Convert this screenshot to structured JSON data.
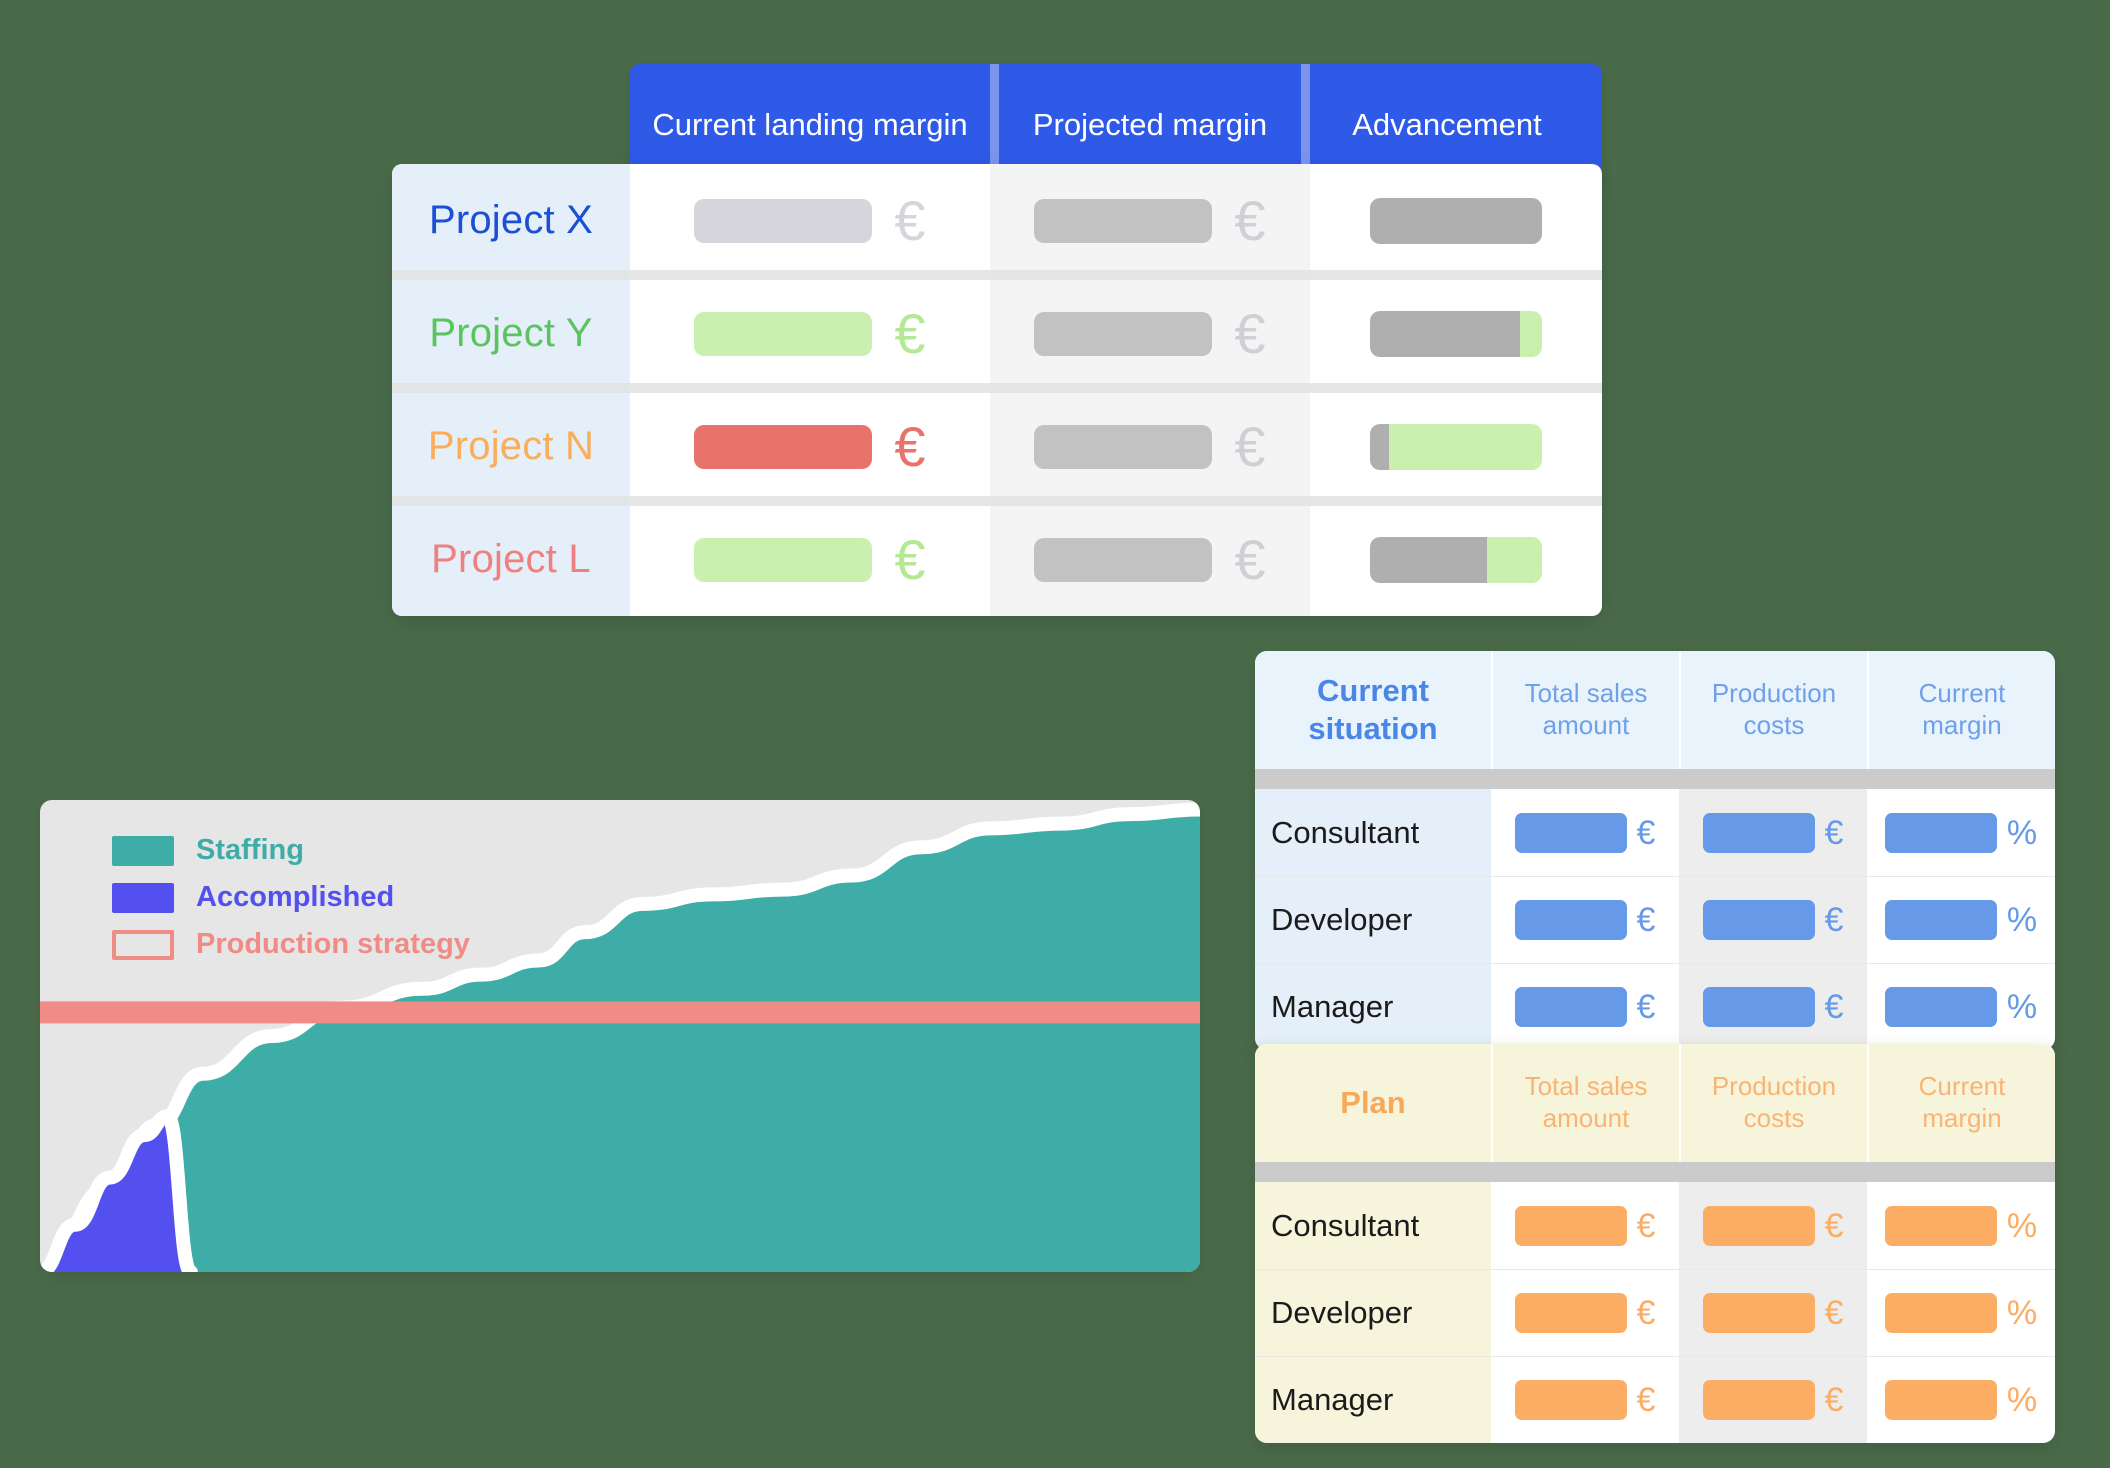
{
  "projects_table": {
    "headers": [
      {
        "label": "Current landing margin"
      },
      {
        "label": "Projected margin"
      },
      {
        "label": "Advancement"
      }
    ],
    "header_bg": "#2F5AE8",
    "header_sep": "#7B95EE",
    "rows": [
      {
        "name": "Project X",
        "name_color": "#1A4FD6",
        "current_margin": {
          "bar_color": "#D5D5DB",
          "unit": "€",
          "unit_color": "#D5D5DB"
        },
        "projected_margin": {
          "bar_color": "#C2C2C2",
          "unit": "€",
          "unit_color": "#CFCFD6"
        },
        "advancement": {
          "percent": 100,
          "fill_color": "#AFAFAF",
          "track_color": "#C9F0AE"
        }
      },
      {
        "name": "Project Y",
        "name_color": "#5CC45F",
        "current_margin": {
          "bar_color": "#C9F0AE",
          "unit": "€",
          "unit_color": "#B4E892"
        },
        "projected_margin": {
          "bar_color": "#C2C2C2",
          "unit": "€",
          "unit_color": "#CFCFD6"
        },
        "advancement": {
          "percent": 87,
          "fill_color": "#AFAFAF",
          "track_color": "#C9F0AE"
        }
      },
      {
        "name": "Project N",
        "name_color": "#F9AE5B",
        "current_margin": {
          "bar_color": "#E8736B",
          "unit": "€",
          "unit_color": "#E8736B"
        },
        "projected_margin": {
          "bar_color": "#C2C2C2",
          "unit": "€",
          "unit_color": "#CFCFD6"
        },
        "advancement": {
          "percent": 11,
          "fill_color": "#AFAFAF",
          "track_color": "#C9F0AE"
        }
      },
      {
        "name": "Project L",
        "name_color": "#F08080",
        "current_margin": {
          "bar_color": "#C9F0AE",
          "unit": "€",
          "unit_color": "#B4E892"
        },
        "projected_margin": {
          "bar_color": "#C2C2C2",
          "unit": "€",
          "unit_color": "#CFCFD6"
        },
        "advancement": {
          "percent": 68,
          "fill_color": "#AFAFAF",
          "track_color": "#C9F0AE"
        }
      }
    ]
  },
  "chart_data": {
    "type": "area",
    "title": "",
    "xlabel": "",
    "ylabel": "",
    "background": "#E6E6E6",
    "grid": false,
    "legend_position": "top-left",
    "xlim": [
      0,
      100
    ],
    "ylim": [
      0,
      100
    ],
    "legend": [
      {
        "label": "Staffing",
        "color": "#3EADA8",
        "style": "filled"
      },
      {
        "label": "Accomplished",
        "color": "#5450F0",
        "style": "filled"
      },
      {
        "label": "Production strategy",
        "color": "#EE8C85",
        "style": "outline"
      }
    ],
    "series": [
      {
        "name": "Staffing",
        "color": "#3EADA8",
        "style": "filled",
        "x": [
          0,
          6,
          10,
          14,
          20,
          26,
          33,
          38,
          43,
          47,
          52,
          58,
          64,
          70,
          76,
          82,
          88,
          94,
          100
        ],
        "y": [
          0,
          18,
          31,
          42,
          50,
          56,
          60,
          63,
          66,
          72,
          78,
          80,
          81,
          84,
          90,
          94,
          95,
          97,
          98
        ]
      },
      {
        "name": "Accomplished",
        "color": "#5450F0",
        "style": "filled",
        "x": [
          0,
          3,
          6,
          9,
          11,
          13
        ],
        "y": [
          0,
          10,
          20,
          29,
          33,
          0
        ]
      }
    ],
    "reference_line": {
      "name": "Production strategy",
      "color": "#EE8C85",
      "orientation": "horizontal",
      "y": 55,
      "thickness_px": 22
    }
  },
  "current_situation": {
    "title": "Current situation",
    "accent": "#4A86E8",
    "headers": [
      "Total sales amount",
      "Production costs",
      "Current margin"
    ],
    "rows": [
      {
        "name": "Consultant",
        "cells": [
          {
            "unit": "€"
          },
          {
            "unit": "€"
          },
          {
            "unit": "%"
          }
        ]
      },
      {
        "name": "Developer",
        "cells": [
          {
            "unit": "€"
          },
          {
            "unit": "€"
          },
          {
            "unit": "%"
          }
        ]
      },
      {
        "name": "Manager",
        "cells": [
          {
            "unit": "€"
          },
          {
            "unit": "€"
          },
          {
            "unit": "%"
          }
        ]
      }
    ]
  },
  "plan": {
    "title": "Plan",
    "accent": "#F7A85C",
    "headers": [
      "Total sales amount",
      "Production costs",
      "Current margin"
    ],
    "rows": [
      {
        "name": "Consultant",
        "cells": [
          {
            "unit": "€"
          },
          {
            "unit": "€"
          },
          {
            "unit": "%"
          }
        ]
      },
      {
        "name": "Developer",
        "cells": [
          {
            "unit": "€"
          },
          {
            "unit": "€"
          },
          {
            "unit": "%"
          }
        ]
      },
      {
        "name": "Manager",
        "cells": [
          {
            "unit": "€"
          },
          {
            "unit": "€"
          },
          {
            "unit": "%"
          }
        ]
      }
    ]
  }
}
